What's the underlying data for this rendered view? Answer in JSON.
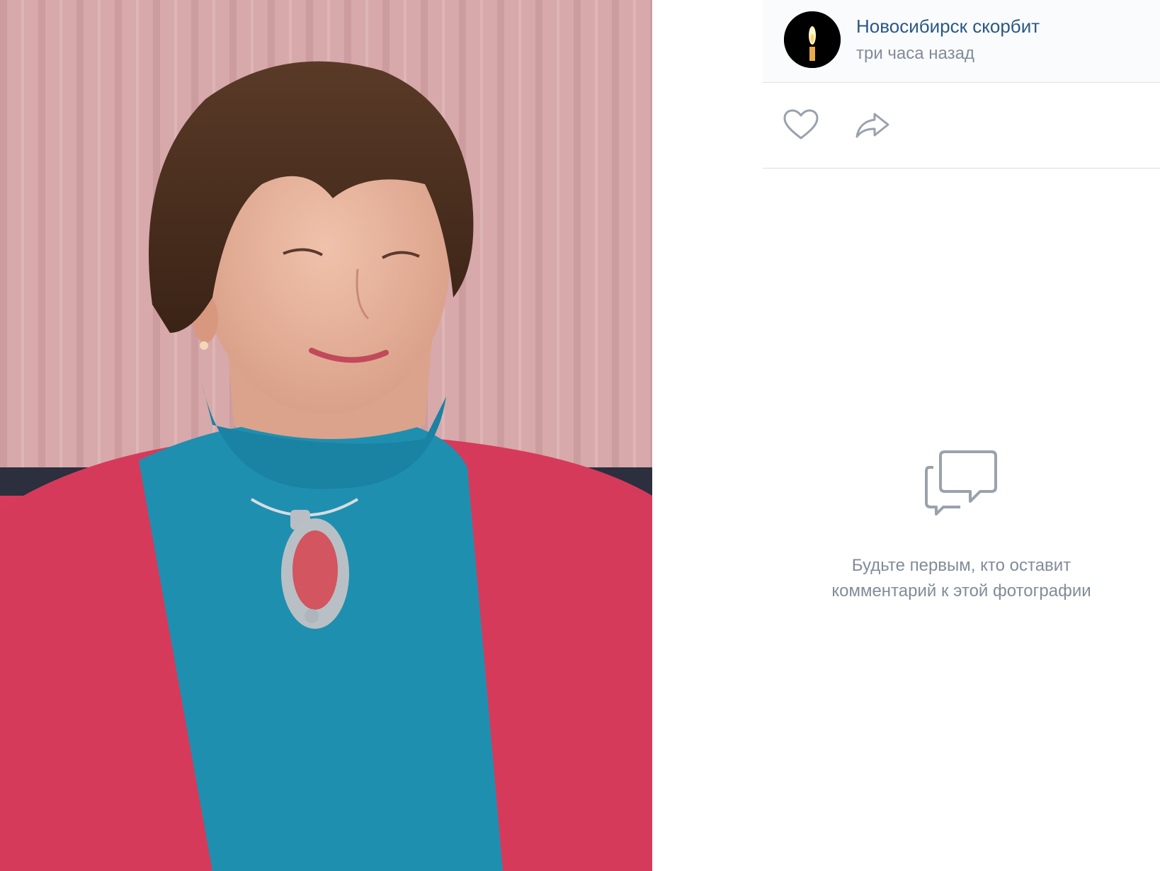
{
  "photo": {
    "subject": "portrait photo",
    "colors": {
      "background": "#d4a6a8",
      "hair": "#4a2e1e",
      "skin": "#e7b39c",
      "turtleneck": "#1f8fb0",
      "cardigan": "#d63a5a",
      "pendant": "#d2555f"
    }
  },
  "post": {
    "author": "Новосибирск скорбит",
    "time": "три часа назад",
    "avatar_icon": "candle-icon"
  },
  "actions": {
    "like_icon": "heart-icon",
    "share_icon": "share-arrow-icon"
  },
  "comments": {
    "empty_icon": "comments-icon",
    "empty_line1": "Будьте первым, кто оставит",
    "empty_line2": "комментарий к этой фотографии"
  },
  "theme": {
    "link": "#2a5885",
    "muted": "#818c99",
    "divider": "#dce1e6",
    "icon": "#99a2ad"
  }
}
